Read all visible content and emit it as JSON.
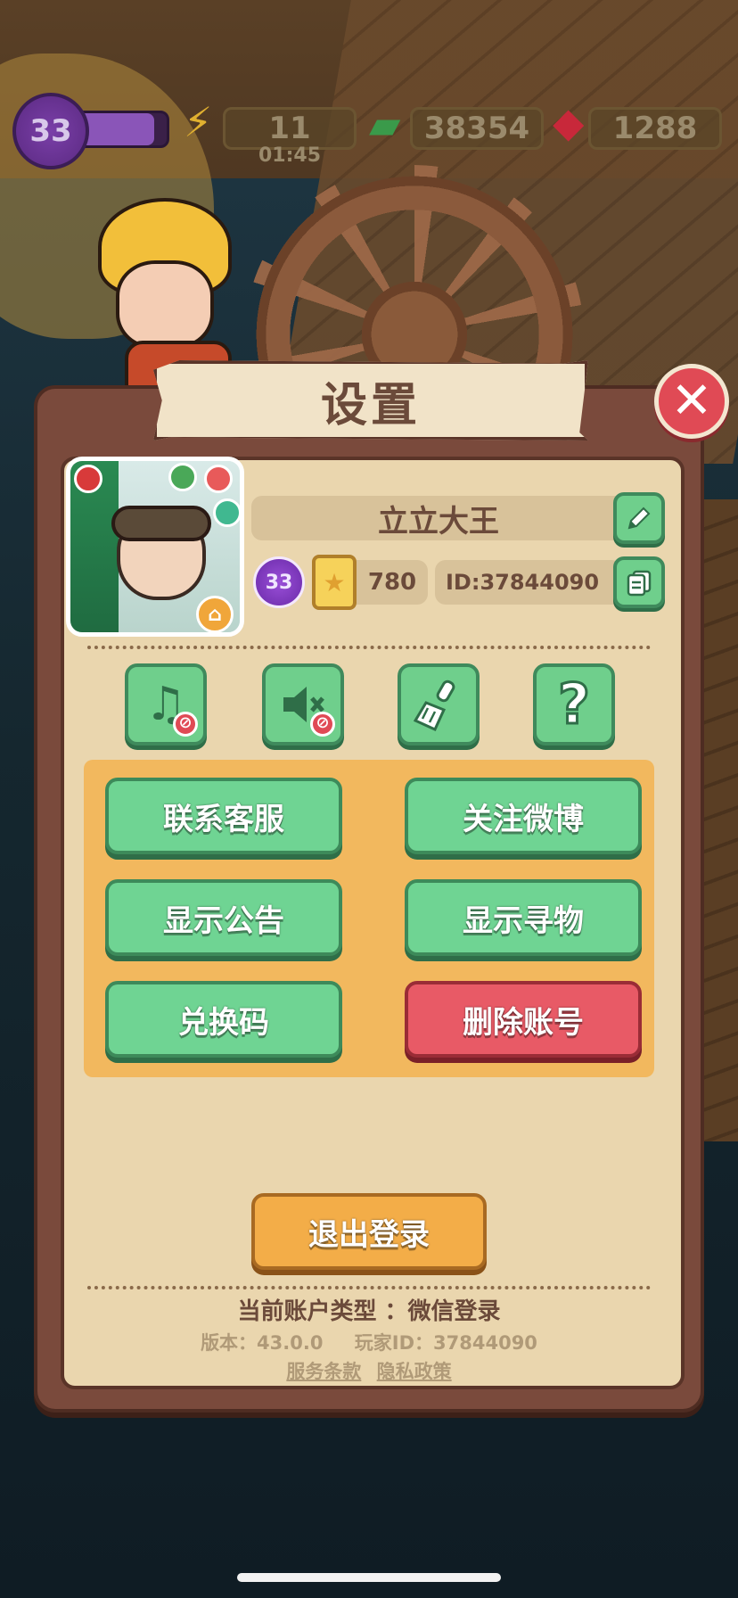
{
  "hud": {
    "level": "33",
    "energy": "11",
    "energy_timer": "01:45",
    "cash": "38354",
    "gems": "1288",
    "level_progress": 0.85
  },
  "dialog": {
    "title": "设置",
    "close_icon": "close-x-icon"
  },
  "profile": {
    "name": "立立大王",
    "level": "33",
    "stars": "780",
    "player_id": "ID:37844090"
  },
  "tools": [
    {
      "name": "music-toggle",
      "icon": "music-note-icon",
      "muted": true
    },
    {
      "name": "sound-toggle",
      "icon": "speaker-icon",
      "muted": true
    },
    {
      "name": "clear-cache",
      "icon": "brush-icon"
    },
    {
      "name": "help",
      "icon": "question-icon"
    }
  ],
  "options": {
    "contact_support": "联系客服",
    "follow_weibo": "关注微博",
    "show_announcement": "显示公告",
    "show_search": "显示寻物",
    "redeem_code": "兑换码",
    "delete_account": "删除账号"
  },
  "footer": {
    "logout": "退出登录",
    "account_type": "当前账户类型 ：微信登录",
    "version": "版本：43.0.0",
    "player_id": "玩家ID：37844090",
    "terms": "服务条款",
    "privacy": "隐私政策"
  },
  "colors": {
    "primary_green": "#6fd493",
    "danger_red": "#e85a66",
    "logout_orange": "#f3ad48",
    "panel_brown": "#7a4a3c",
    "panel_cream": "#ead6ae"
  }
}
